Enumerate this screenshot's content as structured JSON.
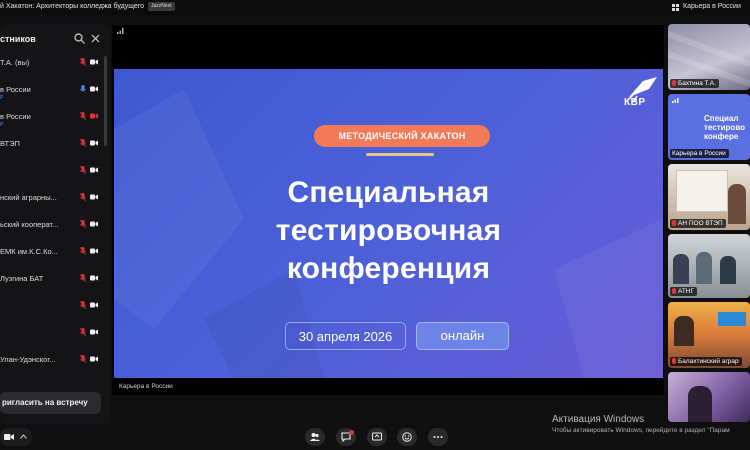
{
  "header": {
    "meeting_title": "й Хакатон: Архитекторы колледжа будущего",
    "badge": "JazzNext",
    "right_label": "Карьера в России"
  },
  "participants_panel": {
    "title": "стников",
    "items": [
      {
        "name": "Т.А. (вы)",
        "sub": "",
        "mic": "muted",
        "cam": "on"
      },
      {
        "name": "в России",
        "sub": "Р",
        "mic": "on",
        "cam": "on"
      },
      {
        "name": "в России",
        "sub": "Р",
        "mic": "muted",
        "cam": "off"
      },
      {
        "name": "ВТЭП",
        "sub": "",
        "mic": "muted",
        "cam": "on"
      },
      {
        "name": "",
        "sub": "",
        "mic": "muted",
        "cam": "on"
      },
      {
        "name": "нский аграрны...",
        "sub": "",
        "mic": "muted",
        "cam": "on"
      },
      {
        "name": "ьский кооперат...",
        "sub": "",
        "mic": "muted",
        "cam": "on"
      },
      {
        "name": "ЕМК им.К.С.Ко...",
        "sub": "",
        "mic": "muted",
        "cam": "on"
      },
      {
        "name": "Лузгина БАТ",
        "sub": "",
        "mic": "muted",
        "cam": "on"
      },
      {
        "name": "",
        "sub": "",
        "mic": "muted",
        "cam": "on"
      },
      {
        "name": "",
        "sub": "",
        "mic": "muted",
        "cam": "on"
      },
      {
        "name": "Улан-Удэнског...",
        "sub": "",
        "mic": "muted",
        "cam": "on"
      }
    ],
    "invite_label": "ригласить на встречу"
  },
  "slide": {
    "badge": "МЕТОДИЧЕСКИЙ ХАКАТОН",
    "title_lines": [
      "Специальная",
      "тестировочная",
      "конференция"
    ],
    "date": "30 апреля 2026",
    "format": "онлайн",
    "logo_text": "КВР"
  },
  "stage_label": "Карьера в России",
  "thumbnails": [
    {
      "label": "Бахтина Т.А."
    },
    {
      "label": "Карьера в России"
    },
    {
      "label": "АН ПОО ВТЭП"
    },
    {
      "label": "АТНГ"
    },
    {
      "label": "Балахтинский аграр"
    }
  ],
  "thumb_slide": {
    "line1": "Специал",
    "line2": "тестирово",
    "line3": "конфере"
  },
  "watermark": {
    "title": "Активация Windows",
    "subtitle": "Чтобы активировать Windows, перейдите в раздел \"Парам"
  },
  "colors": {
    "slide_bg": "#4b60d8",
    "badge": "#f27a57",
    "mic_muted": "#e0343d",
    "accent": "#4f8cff"
  }
}
